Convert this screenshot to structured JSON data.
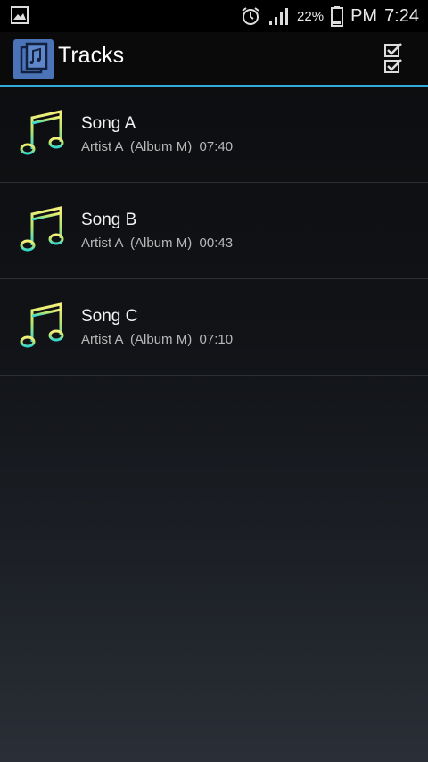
{
  "status_bar": {
    "battery_percent": "22%",
    "am_pm": "PM",
    "time": "7:24",
    "icons": [
      "gallery-icon",
      "alarm-icon",
      "signal-icon",
      "battery-icon"
    ]
  },
  "action_bar": {
    "title": "Tracks",
    "app_icon": "music-app-icon",
    "select_icon": "checklist-icon",
    "accent_color": "#33aade"
  },
  "tracks": [
    {
      "title": "Song A",
      "artist": "Artist A",
      "album": "(Album M)",
      "duration": "07:40"
    },
    {
      "title": "Song B",
      "artist": "Artist A",
      "album": "(Album M)",
      "duration": "00:43"
    },
    {
      "title": "Song C",
      "artist": "Artist A",
      "album": "(Album M)",
      "duration": "07:10"
    }
  ]
}
